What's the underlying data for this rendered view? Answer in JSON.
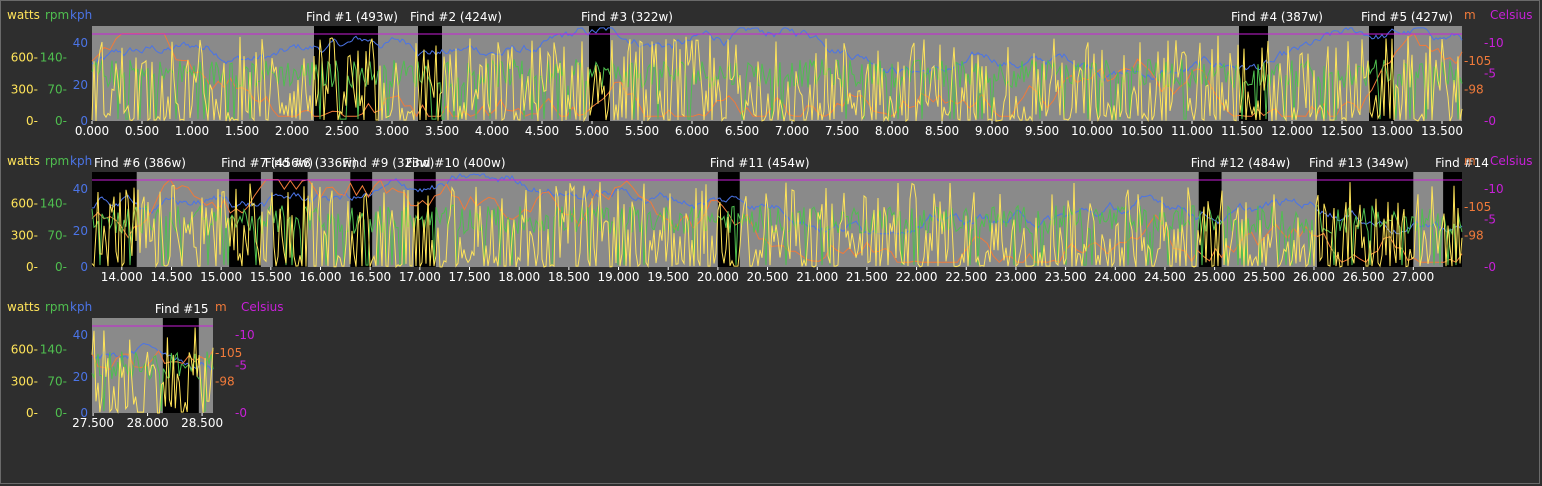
{
  "colors": {
    "background": "#2e2e2e",
    "plot_bg": "#8a8a8a",
    "find_bg": "#000000",
    "watts": "#ffe45a",
    "rpm": "#4fbf4f",
    "kph": "#4b74e6",
    "altitude": "#f07a3a",
    "temperature": "#c820d8",
    "axis_text": "#ffffff"
  },
  "axis_labels": {
    "watts": "watts",
    "rpm": "rpm",
    "kph": "kph",
    "altitude": "m",
    "temperature": "Celsius"
  },
  "chart_data": {
    "type": "line",
    "x_unit": "km",
    "series": [
      {
        "name": "watts",
        "axis": "watts",
        "ticks": [
          0,
          300,
          600
        ]
      },
      {
        "name": "rpm",
        "axis": "rpm",
        "ticks": [
          0,
          70,
          140
        ]
      },
      {
        "name": "kph",
        "axis": "kph",
        "ticks": [
          0,
          20,
          40
        ]
      },
      {
        "name": "m",
        "axis": "altitude",
        "ticks": [
          98,
          105
        ]
      },
      {
        "name": "Celsius",
        "axis": "temperature",
        "ticks": [
          0,
          -5,
          -10
        ]
      }
    ],
    "finds": [
      {
        "label": "Find #1 (493w)",
        "start": 2.22,
        "end": 2.86
      },
      {
        "label": "Find #2 (424w)",
        "start": 3.26,
        "end": 3.5
      },
      {
        "label": "Find #3 (322w)",
        "start": 4.97,
        "end": 5.18
      },
      {
        "label": "Find #4 (387w)",
        "start": 11.47,
        "end": 11.76
      },
      {
        "label": "Find #5 (427w)",
        "start": 12.77,
        "end": 13.02
      },
      {
        "label": "Find #6 (386w)",
        "start": 13.7,
        "end": 14.15
      },
      {
        "label": "Find #7 (456w)",
        "start": 15.08,
        "end": 15.4
      },
      {
        "label": "Find #8 (336w)",
        "start": 15.52,
        "end": 15.87
      },
      {
        "label": "Find #9 (323w)",
        "start": 16.3,
        "end": 16.52
      },
      {
        "label": "Find #10 (400w)",
        "start": 16.94,
        "end": 17.16
      },
      {
        "label": "Find #11 (454w)",
        "start": 20.0,
        "end": 20.22
      },
      {
        "label": "Find #12 (484w)",
        "start": 24.84,
        "end": 25.07
      },
      {
        "label": "Find #13 (349w)",
        "start": 26.03,
        "end": 27.0
      },
      {
        "label": "Find #14",
        "start": 27.3,
        "end": 27.49
      },
      {
        "label": "Find #15",
        "start": 28.14,
        "end": 28.47
      }
    ],
    "panels": [
      {
        "x_range": [
          0.0,
          13.7
        ],
        "x_ticks": [
          "0.000",
          "0.500",
          "1.000",
          "1.500",
          "2.000",
          "2.500",
          "3.000",
          "3.500",
          "4.000",
          "4.500",
          "5.000",
          "5.500",
          "6.000",
          "6.500",
          "7.000",
          "7.500",
          "8.000",
          "8.500",
          "9.000",
          "9.500",
          "10.000",
          "10.500",
          "11.000",
          "11.500",
          "12.000",
          "12.500",
          "13.000",
          "13.500"
        ],
        "finds": [
          0,
          1,
          2,
          3,
          4
        ]
      },
      {
        "x_range": [
          13.7,
          27.49
        ],
        "x_ticks": [
          "14.000",
          "14.500",
          "15.000",
          "15.500",
          "16.000",
          "16.500",
          "17.000",
          "17.500",
          "18.000",
          "18.500",
          "19.000",
          "19.500",
          "20.000",
          "20.500",
          "21.000",
          "21.500",
          "22.000",
          "22.500",
          "23.000",
          "23.500",
          "24.000",
          "24.500",
          "25.000",
          "25.500",
          "26.000",
          "26.500",
          "27.000"
        ],
        "finds": [
          5,
          6,
          7,
          8,
          9,
          10,
          11,
          12,
          13
        ]
      },
      {
        "x_range": [
          27.49,
          28.6
        ],
        "x_ticks": [
          "27.500",
          "28.000",
          "28.500"
        ],
        "finds": [
          14
        ]
      }
    ]
  }
}
